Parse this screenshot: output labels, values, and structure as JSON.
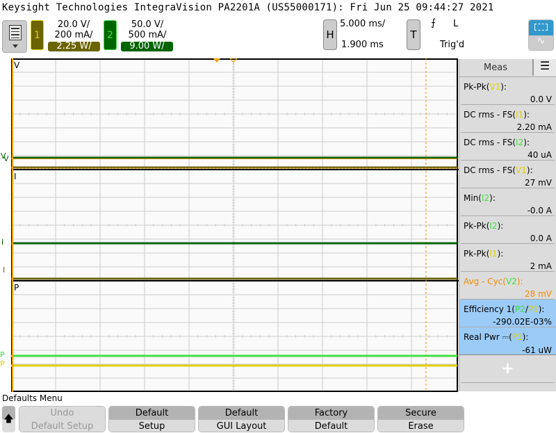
{
  "title": "Keysight Technologies IntegraVision PA2201A (US55000171): Fri Jun 25 09:44:27 2021",
  "channels": [
    {
      "number": "1",
      "volts": "20.0 V/",
      "amps": "200 mA/",
      "power": "2.25 W/",
      "color": "#6b6400",
      "border": "#e0d000"
    },
    {
      "number": "2",
      "volts": "50.0 V/",
      "amps": "500 mA/",
      "power": "9.00 W/",
      "color": "#006400",
      "border": "#3ee03e"
    }
  ],
  "horizontal": {
    "button": "H",
    "scale": "5.000 ms/",
    "delay": "1.900 ms"
  },
  "trigger": {
    "button": "T",
    "slope_icon": "rising-edge-icon",
    "level": "L",
    "status": "Trig'd"
  },
  "plot": {
    "panes": [
      "V",
      "I",
      "P"
    ],
    "markers": {
      "v": "V",
      "i": "I",
      "p": "P"
    }
  },
  "meas": {
    "title": "Meas",
    "items": [
      {
        "pre": "Pk-Pk(",
        "src": "V1",
        "src_color": "y",
        "post": "):",
        "value": "0.0 V"
      },
      {
        "pre": "DC rms - FS(",
        "src": "I1",
        "src_color": "y",
        "post": "):",
        "value": "2.20 mA"
      },
      {
        "pre": "DC rms - FS(",
        "src": "I2",
        "src_color": "g",
        "post": "):",
        "value": "40 uA"
      },
      {
        "pre": "DC rms - FS(",
        "src": "V1",
        "src_color": "y",
        "post": "):",
        "value": "27 mV"
      },
      {
        "pre": "Min(",
        "src": "I2",
        "src_color": "g",
        "post": "):",
        "value": "-0.0 A"
      },
      {
        "pre": "Pk-Pk(",
        "src": "I2",
        "src_color": "g",
        "post": "):",
        "value": "0.0 A"
      },
      {
        "pre": "Pk-Pk(",
        "src": "I1",
        "src_color": "y",
        "post": "):",
        "value": "2 mA"
      },
      {
        "pre": "Avg - Cyc(",
        "src": "V2",
        "src_color": "g",
        "post": "):",
        "value": "28 mV"
      }
    ],
    "efficiency": {
      "pre": "Efficiency 1(",
      "a": "P2",
      "sep": "/",
      "b": "P1",
      "post": "):",
      "value": "-290.02E-03%"
    },
    "realpwr": {
      "pre": "Real Pwr ",
      "dc": "⎓",
      "open": "(",
      "src": "P1",
      "post": "):",
      "value": "-61 uW"
    },
    "add": "+"
  },
  "softkeys": {
    "menu_title": "Defaults Menu",
    "keys": [
      {
        "top": "Undo",
        "bottom": "Default Setup",
        "enabled": false
      },
      {
        "top": "Default",
        "bottom": "Setup",
        "enabled": true
      },
      {
        "top": "Default",
        "bottom": "GUI Layout",
        "enabled": true
      },
      {
        "top": "Factory",
        "bottom": "Default",
        "enabled": true
      },
      {
        "top": "Secure",
        "bottom": "Erase",
        "enabled": true
      }
    ]
  }
}
